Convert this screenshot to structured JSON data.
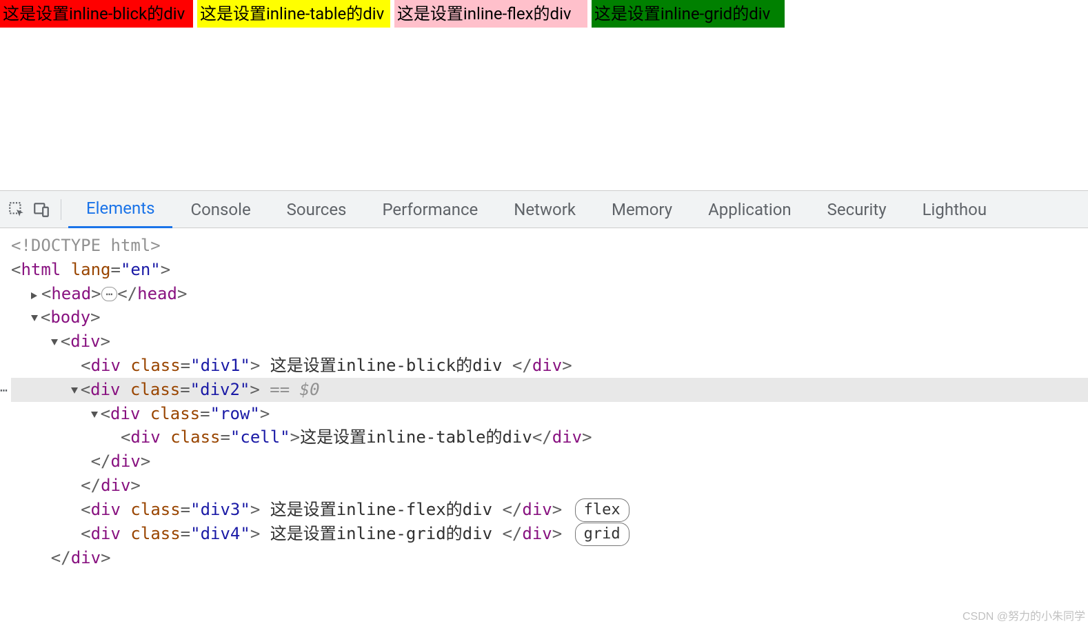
{
  "preview": {
    "box1": "这是设置inline-blick的div",
    "box2": "这是设置inline-table的div",
    "box3": "这是设置inline-flex的div",
    "box4": "这是设置inline-grid的div"
  },
  "devtools": {
    "tabs": [
      "Elements",
      "Console",
      "Sources",
      "Performance",
      "Network",
      "Memory",
      "Application",
      "Security",
      "Lighthou"
    ],
    "activeTab": "Elements"
  },
  "dom": {
    "doctype": "<!DOCTYPE html>",
    "htmlOpen": {
      "tag": "html",
      "attr": "lang",
      "val": "\"en\""
    },
    "head": {
      "open": "head",
      "close": "head",
      "ellipsis": "⋯"
    },
    "body": {
      "tag": "body"
    },
    "div": {
      "tag": "div"
    },
    "div1": {
      "tag": "div",
      "attr": "class",
      "val": "\"div1\"",
      "text": " 这是设置inline-blick的div ",
      "close": "div"
    },
    "div2": {
      "tag": "div",
      "attr": "class",
      "val": "\"div2\"",
      "trail": " == $0"
    },
    "row": {
      "tag": "div",
      "attr": "class",
      "val": "\"row\""
    },
    "cell": {
      "tag": "div",
      "attr": "class",
      "val": "\"cell\"",
      "text": "这是设置inline-table的div",
      "close": "div"
    },
    "rowClose": "div",
    "div2Close": "div",
    "div3": {
      "tag": "div",
      "attr": "class",
      "val": "\"div3\"",
      "text": " 这是设置inline-flex的div ",
      "close": "div",
      "badge": "flex"
    },
    "div4": {
      "tag": "div",
      "attr": "class",
      "val": "\"div4\"",
      "text": " 这是设置inline-grid的div ",
      "close": "div",
      "badge": "grid"
    },
    "divClose": "div"
  },
  "watermark": "CSDN @努力的小朱同学"
}
